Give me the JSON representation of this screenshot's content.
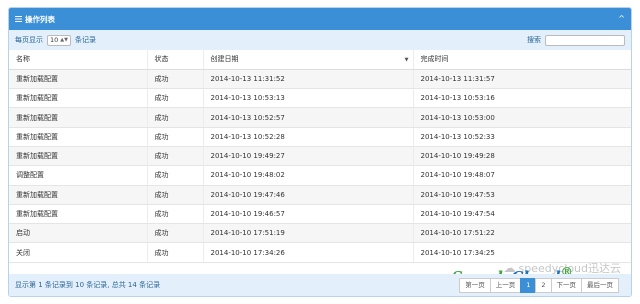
{
  "panel": {
    "title": "操作列表",
    "collapse_glyph": "^"
  },
  "toolbar": {
    "per_page_prefix": "每页显示",
    "per_page_value": "10",
    "per_page_suffix": "条记录",
    "search_label": "搜索",
    "search_value": ""
  },
  "table": {
    "headers": [
      "名称",
      "状态",
      "创建日期",
      "完成时间"
    ],
    "rows": [
      [
        "重新加载配置",
        "成功",
        "2014-10-13 11:31:52",
        "2014-10-13 11:31:57"
      ],
      [
        "重新加载配置",
        "成功",
        "2014-10-13 10:53:13",
        "2014-10-13 10:53:16"
      ],
      [
        "重新加载配置",
        "成功",
        "2014-10-13 10:52:57",
        "2014-10-13 10:53:00"
      ],
      [
        "重新加载配置",
        "成功",
        "2014-10-13 10:52:28",
        "2014-10-13 10:52:33"
      ],
      [
        "重新加载配置",
        "成功",
        "2014-10-10 19:49:27",
        "2014-10-10 19:49:28"
      ],
      [
        "调整配置",
        "成功",
        "2014-10-10 19:48:02",
        "2014-10-10 19:48:07"
      ],
      [
        "重新加载配置",
        "成功",
        "2014-10-10 19:47:46",
        "2014-10-10 19:47:53"
      ],
      [
        "重新加载配置",
        "成功",
        "2014-10-10 19:46:57",
        "2014-10-10 19:47:54"
      ],
      [
        "启动",
        "成功",
        "2014-10-10 17:51:19",
        "2014-10-10 17:51:22"
      ],
      [
        "关闭",
        "成功",
        "2014-10-10 17:34:26",
        "2014-10-10 17:34:25"
      ]
    ]
  },
  "footer": {
    "info": "显示第 1 条记录到 10 条记录, 总共 14 条记录",
    "pager": [
      "第一页",
      "上一页",
      "1",
      "2",
      "下一页",
      "最后一页"
    ],
    "active_page": "1"
  },
  "watermark": {
    "text": "speedycloud迅达云",
    "logo_part1": "Speedy",
    "logo_part2": "Cloud",
    "logo_mark": "®"
  },
  "colors": {
    "header_blue": "#3b8fd6",
    "toolbar_bg": "#e3f0fb",
    "logo_green": "#3fa33b",
    "logo_blue": "#1d6fc1"
  },
  "icons": {
    "header": "list-icon",
    "collapse": "chevron-up-icon",
    "select": "caret-updown-icon",
    "sort": "sort-desc-icon",
    "watermark": "wechat-icon"
  }
}
